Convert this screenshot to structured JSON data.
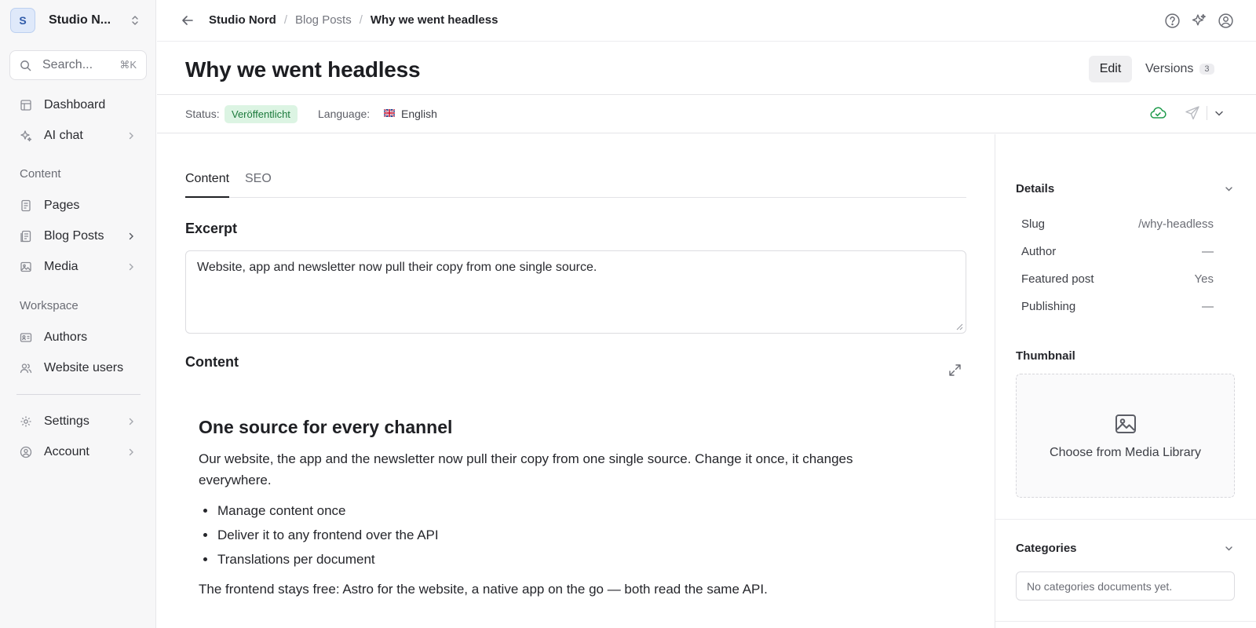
{
  "workspace": {
    "avatar_letter": "S",
    "name": "Studio N..."
  },
  "search": {
    "placeholder": "Search...",
    "shortcut": "⌘K"
  },
  "sidebar": {
    "top_items": [
      {
        "label": "Dashboard",
        "icon": "dashboard-icon"
      },
      {
        "label": "AI chat",
        "icon": "sparkle-icon",
        "has_submenu": true
      }
    ],
    "content_section": {
      "label": "Content",
      "items": [
        {
          "label": "Pages",
          "icon": "page-icon"
        },
        {
          "label": "Blog Posts",
          "icon": "blog-posts-icon",
          "has_submenu": true
        },
        {
          "label": "Media",
          "icon": "image-icon",
          "has_submenu": true
        }
      ]
    },
    "workspace_section": {
      "label": "Workspace",
      "items": [
        {
          "label": "Authors",
          "icon": "id-card-icon"
        },
        {
          "label": "Website users",
          "icon": "users-icon"
        }
      ]
    },
    "bottom_items": [
      {
        "label": "Settings",
        "icon": "gear-icon",
        "has_submenu": true
      },
      {
        "label": "Account",
        "icon": "account-icon",
        "has_submenu": true
      }
    ]
  },
  "breadcrumb": [
    "Studio Nord",
    "Blog Posts",
    "Why we went headless"
  ],
  "header_icons": [
    "help-icon",
    "sparkle-icon",
    "user-icon"
  ],
  "document": {
    "title": "Why we went headless",
    "edit_label": "Edit",
    "versions_label": "Versions",
    "versions_count": "3"
  },
  "status": {
    "label": "Status:",
    "value": "Veröffentlicht",
    "language_label": "Language:",
    "language_value": "English",
    "colors": {
      "badge_bg": "#dcf4e3",
      "badge_text": "#1c7a3c",
      "cloud": "#1e9a4b"
    }
  },
  "tabs": [
    "Content",
    "SEO"
  ],
  "excerpt": {
    "label": "Excerpt",
    "value": "Website, app and newsletter now pull their copy from one single source."
  },
  "content": {
    "label": "Content",
    "heading": "One source for every channel",
    "paragraph": "Our website, the app and the newsletter now pull their copy from one single source. Change it once, it changes everywhere.",
    "bullets": [
      "Manage content once",
      "Deliver it to any frontend over the API",
      "Translations per document"
    ],
    "closing": "The frontend stays free: Astro for the website, a native app on the go — both read the same API."
  },
  "details": {
    "label": "Details",
    "rows": [
      {
        "key": "Slug",
        "value": "/why-headless"
      },
      {
        "key": "Author",
        "value": "—"
      },
      {
        "key": "Featured post",
        "value": "Yes"
      },
      {
        "key": "Publishing",
        "value": "—"
      }
    ]
  },
  "thumbnail": {
    "label": "Thumbnail",
    "action": "Choose from Media Library"
  },
  "categories": {
    "label": "Categories",
    "empty_text": "No categories documents yet."
  }
}
